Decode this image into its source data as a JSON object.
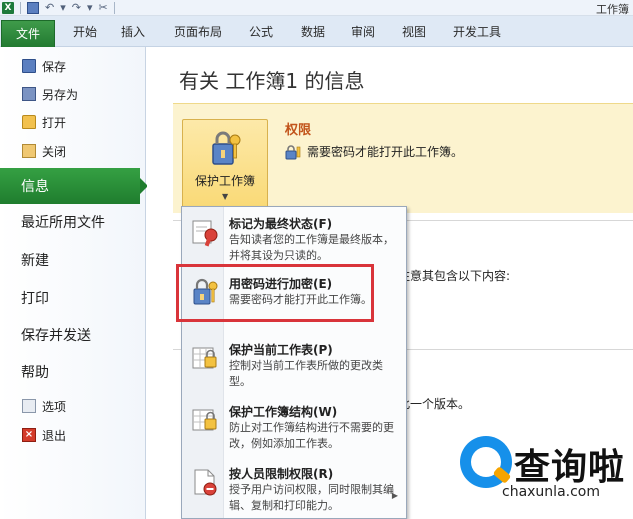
{
  "window": {
    "title": "工作簿"
  },
  "ribbon": {
    "tabs": [
      {
        "label": "文件"
      },
      {
        "label": "开始"
      },
      {
        "label": "插入"
      },
      {
        "label": "页面布局"
      },
      {
        "label": "公式"
      },
      {
        "label": "数据"
      },
      {
        "label": "审阅"
      },
      {
        "label": "视图"
      },
      {
        "label": "开发工具"
      }
    ]
  },
  "nav": {
    "items": [
      {
        "label": "保存",
        "icon": "save-icon"
      },
      {
        "label": "另存为",
        "icon": "save-as-icon"
      },
      {
        "label": "打开",
        "icon": "open-folder-icon"
      },
      {
        "label": "关闭",
        "icon": "close-folder-icon"
      },
      {
        "label": "信息"
      },
      {
        "label": "最近所用文件"
      },
      {
        "label": "新建"
      },
      {
        "label": "打印"
      },
      {
        "label": "保存并发送"
      },
      {
        "label": "帮助"
      },
      {
        "label": "选项",
        "icon": "options-icon"
      },
      {
        "label": "退出",
        "icon": "exit-icon"
      }
    ]
  },
  "info": {
    "title": "有关 工作簿1 的信息",
    "protect_button": "保护工作簿",
    "permissions_heading": "权限",
    "permissions_desc": "需要密码才能打开此工作簿。",
    "bg_text_1": "注意其包含以下内容:",
    "bg_text_2": "此一个版本。"
  },
  "menu": {
    "items": [
      {
        "title": "标记为最终状态(F)",
        "desc": "告知读者您的工作簿是最终版本，并将其设为只读的。",
        "icon": "mark-final-icon"
      },
      {
        "title": "用密码进行加密(E)",
        "desc": "需要密码才能打开此工作簿。",
        "icon": "encrypt-password-icon"
      },
      {
        "title": "保护当前工作表(P)",
        "desc": "控制对当前工作表所做的更改类型。",
        "icon": "protect-sheet-icon"
      },
      {
        "title": "保护工作簿结构(W)",
        "desc": "防止对工作簿结构进行不需要的更改，例如添加工作表。",
        "icon": "protect-structure-icon"
      },
      {
        "title": "按人员限制权限(R)",
        "desc": "授予用户访问权限，同时限制其编辑、复制和打印能力。",
        "icon": "restrict-permission-icon"
      }
    ]
  },
  "watermark": {
    "brand": "查询啦",
    "url": "chaxunla.com"
  },
  "colors": {
    "file_tab": "#2a8537",
    "nav_active": "#2a8d39",
    "highlight": "#d9343a",
    "panel": "#fcf3cf",
    "permission_heading": "#c2541b"
  }
}
